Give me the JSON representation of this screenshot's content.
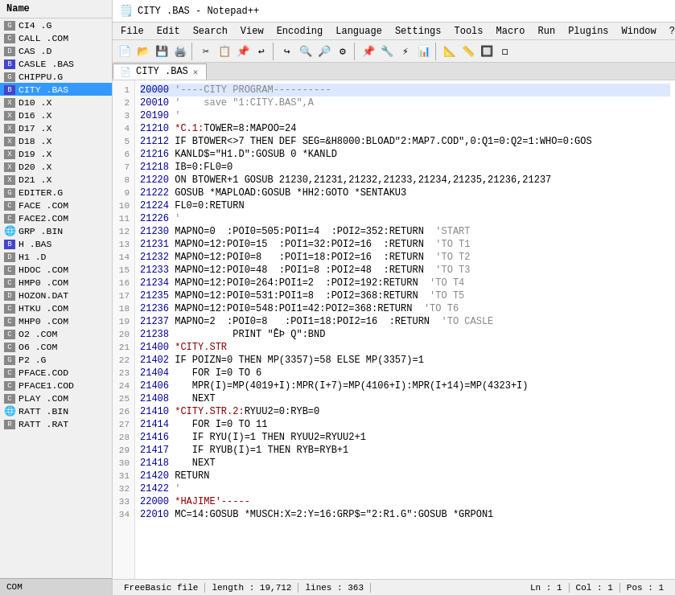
{
  "app": {
    "title": "CITY .BAS - Notepad++",
    "icon": "📄"
  },
  "menubar": {
    "items": [
      "File",
      "Edit",
      "Search",
      "View",
      "Encoding",
      "Language",
      "Settings",
      "Tools",
      "Macro",
      "Run",
      "Plugins",
      "Window",
      "?"
    ]
  },
  "tabs": [
    {
      "label": "CITY .BAS",
      "active": true,
      "close": "✕"
    }
  ],
  "sidebar": {
    "header": "Name",
    "items": [
      {
        "name": "CI4 .G",
        "icon_type": "g"
      },
      {
        "name": "CALL .COM",
        "icon_type": "com"
      },
      {
        "name": "CAS .D",
        "icon_type": "d"
      },
      {
        "name": "CASLE .BAS",
        "icon_type": "bas"
      },
      {
        "name": "CHIPPU.G",
        "icon_type": "g"
      },
      {
        "name": "CITY .BAS",
        "icon_type": "bas",
        "active": true
      },
      {
        "name": "D10  .X",
        "icon_type": "x"
      },
      {
        "name": "D16  .X",
        "icon_type": "x"
      },
      {
        "name": "D17  .X",
        "icon_type": "x"
      },
      {
        "name": "D18  .X",
        "icon_type": "x"
      },
      {
        "name": "D19  .X",
        "icon_type": "x"
      },
      {
        "name": "D20  .X",
        "icon_type": "x"
      },
      {
        "name": "D21  .X",
        "icon_type": "x"
      },
      {
        "name": "EDITER.G",
        "icon_type": "g"
      },
      {
        "name": "FACE .COM",
        "icon_type": "com"
      },
      {
        "name": "FACE2.COM",
        "icon_type": "com"
      },
      {
        "name": "GRP  .BIN",
        "icon_type": "bin",
        "globe": true
      },
      {
        "name": "H    .BAS",
        "icon_type": "bas"
      },
      {
        "name": "H1   .D",
        "icon_type": "d"
      },
      {
        "name": "HDOC .COM",
        "icon_type": "com"
      },
      {
        "name": "HMP0 .COM",
        "icon_type": "com"
      },
      {
        "name": "HOZON.DAT",
        "icon_type": "dat"
      },
      {
        "name": "HTKU .COM",
        "icon_type": "com"
      },
      {
        "name": "MHP0 .COM",
        "icon_type": "com"
      },
      {
        "name": "O2   .COM",
        "icon_type": "com"
      },
      {
        "name": "O6   .COM",
        "icon_type": "com"
      },
      {
        "name": "P2   .G",
        "icon_type": "g"
      },
      {
        "name": "PFACE.COD",
        "icon_type": "cod"
      },
      {
        "name": "PFACE1.COD",
        "icon_type": "cod"
      },
      {
        "name": "PLAY .COM",
        "icon_type": "com"
      },
      {
        "name": "RATT .BIN",
        "icon_type": "bin",
        "globe": true
      },
      {
        "name": "RATT .RAT",
        "icon_type": "rat"
      }
    ],
    "footer": "COM"
  },
  "code": {
    "lines": [
      {
        "num": 1,
        "addr": "20000",
        "content": "'----CITY PROGRAM----------",
        "style": "comment",
        "highlighted": true
      },
      {
        "num": 2,
        "addr": "20010",
        "content": "'    save \"1:CITY.BAS\",A",
        "style": "comment"
      },
      {
        "num": 3,
        "addr": "20190",
        "content": "'",
        "style": "comment"
      },
      {
        "num": 4,
        "addr": "21210",
        "content": "*C.1:TOWER=8:MAPOO=24",
        "style": "label"
      },
      {
        "num": 5,
        "addr": "21212",
        "content": "IF BTOWER<>7 THEN DEF SEG=&H8000:BLOAD\"2:MAP7.COD\",0:Q1=0:Q2=1:WHO=0:GOS",
        "style": "normal"
      },
      {
        "num": 6,
        "addr": "21216",
        "content": "KANLD$=\"H1.D\":GOSUB 0 *KANLD",
        "style": "normal"
      },
      {
        "num": 7,
        "addr": "21218",
        "content": "IB=0:FL0=0",
        "style": "normal"
      },
      {
        "num": 8,
        "addr": "21220",
        "content": "ON BTOWER+1 GOSUB 21230,21231,21232,21233,21234,21235,21236,21237",
        "style": "normal"
      },
      {
        "num": 9,
        "addr": "21222",
        "content": "GOSUB *MAPLOAD:GOSUB *HH2:GOTO *SENTAKU3",
        "style": "normal"
      },
      {
        "num": 10,
        "addr": "21224",
        "content": "FL0=0:RETURN",
        "style": "normal"
      },
      {
        "num": 11,
        "addr": "21226",
        "content": "'",
        "style": "comment"
      },
      {
        "num": 12,
        "addr": "21230",
        "content": "MAPNO=0  :POI0=505:POI1=4  :POI2=352:RETURN  'START",
        "style": "normal"
      },
      {
        "num": 13,
        "addr": "21231",
        "content": "MAPNO=12:POI0=15  :POI1=32:POI2=16  :RETURN  'TO T1",
        "style": "normal"
      },
      {
        "num": 14,
        "addr": "21232",
        "content": "MAPNO=12:POI0=8   :POI1=18:POI2=16  :RETURN  'TO T2",
        "style": "normal"
      },
      {
        "num": 15,
        "addr": "21233",
        "content": "MAPNO=12:POI0=48  :POI1=8 :POI2=48  :RETURN  'TO T3",
        "style": "normal"
      },
      {
        "num": 16,
        "addr": "21234",
        "content": "MAPNO=12:POI0=264:POI1=2  :POI2=192:RETURN  'TO T4",
        "style": "normal"
      },
      {
        "num": 17,
        "addr": "21235",
        "content": "MAPNO=12:POI0=531:POI1=8  :POI2=368:RETURN  'TO T5",
        "style": "normal"
      },
      {
        "num": 18,
        "addr": "21236",
        "content": "MAPNO=12:POI0=548:POI1=42:POI2=368:RETURN  'TO T6",
        "style": "normal"
      },
      {
        "num": 19,
        "addr": "21237",
        "content": "MAPNO=2  :POI0=8   :POI1=18:POI2=16  :RETURN  'TO CASLE",
        "style": "normal"
      },
      {
        "num": 20,
        "addr": "21238",
        "content": "          PRINT \"ÊÞ Q\":BND",
        "style": "normal"
      },
      {
        "num": 21,
        "addr": "21400",
        "content": "*CITY.STR",
        "style": "label"
      },
      {
        "num": 22,
        "addr": "21402",
        "content": "IF POIZN=0 THEN MP(3357)=58 ELSE MP(3357)=1",
        "style": "normal"
      },
      {
        "num": 23,
        "addr": "21404",
        "content": "   FOR I=0 TO 6",
        "style": "normal"
      },
      {
        "num": 24,
        "addr": "21406",
        "content": "   MPR(I)=MP(4019+I):MPR(I+7)=MP(4106+I):MPR(I+14)=MP(4323+I)",
        "style": "normal"
      },
      {
        "num": 25,
        "addr": "21408",
        "content": "   NEXT",
        "style": "normal"
      },
      {
        "num": 26,
        "addr": "21410",
        "content": "*CITY.STR.2:RYUU2=0:RYB=0",
        "style": "label"
      },
      {
        "num": 27,
        "addr": "21414",
        "content": "   FOR I=0 TO 11",
        "style": "normal"
      },
      {
        "num": 28,
        "addr": "21416",
        "content": "   IF RYU(I)=1 THEN RYUU2=RYUU2+1",
        "style": "normal"
      },
      {
        "num": 29,
        "addr": "21417",
        "content": "   IF RYUB(I)=1 THEN RYB=RYB+1",
        "style": "normal"
      },
      {
        "num": 30,
        "addr": "21418",
        "content": "   NEXT",
        "style": "normal"
      },
      {
        "num": 31,
        "addr": "21420",
        "content": "RETURN",
        "style": "normal"
      },
      {
        "num": 32,
        "addr": "21422",
        "content": "'",
        "style": "comment"
      },
      {
        "num": 33,
        "addr": "22000",
        "content": "*HAJIME'-----",
        "style": "label"
      },
      {
        "num": 34,
        "addr": "22010",
        "content": "MC=14:GOSUB *MUSCH:X=2:Y=16:GRP$=\"2:R1.G\":GOSUB *GRPON1",
        "style": "normal"
      }
    ]
  },
  "statusbar": {
    "file_type": "FreeBasic file",
    "length": "length : 19,712",
    "lines": "lines : 363",
    "ln": "Ln : 1",
    "col": "Col : 1",
    "pos": "Pos : 1"
  },
  "toolbar_icons": [
    "📄",
    "💾",
    "📋",
    "✂️",
    "📎",
    "↩️",
    "↪️",
    "🔍",
    "🔎",
    "⚙️",
    "📌"
  ],
  "colors": {
    "highlight_bg": "#dce8ff",
    "active_tab_bg": "#ffffff",
    "sidebar_active": "#3399ff",
    "line_num_color": "#888888",
    "label_color": "#880000",
    "comment_color": "#888888",
    "keyword_color": "#000099"
  }
}
